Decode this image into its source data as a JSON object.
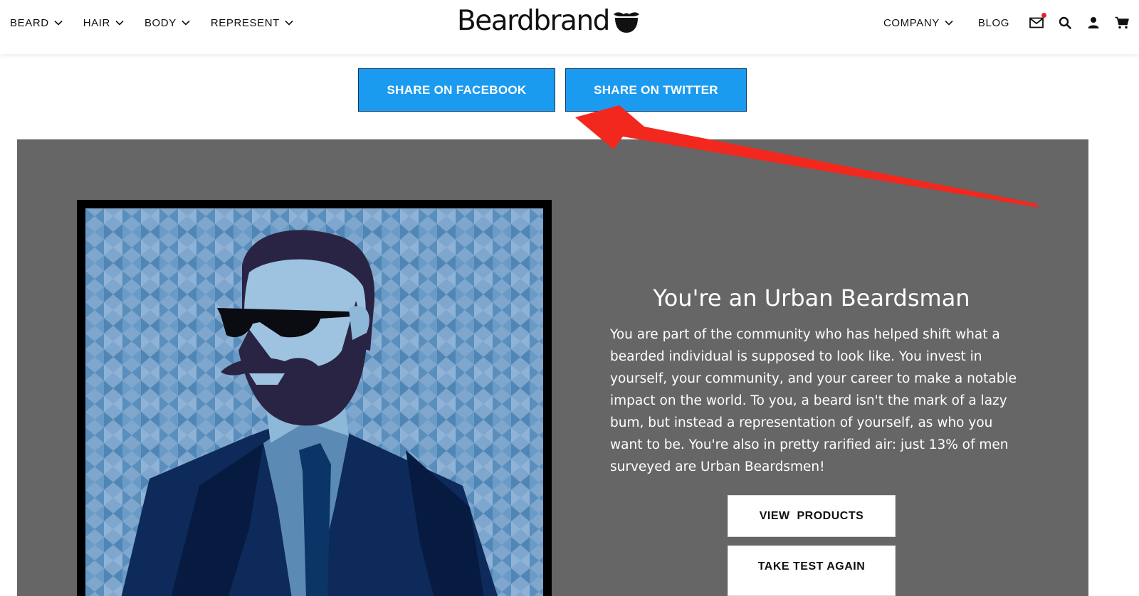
{
  "nav": {
    "left": [
      "BEARD",
      "HAIR",
      "BODY",
      "REPRESENT"
    ],
    "company": "COMPANY",
    "blog": "BLOG",
    "icons": [
      "mail-icon",
      "search-icon",
      "account-icon",
      "cart-icon"
    ]
  },
  "logo": {
    "text": "Beardbrand",
    "icon": "mustache-beard-icon"
  },
  "share": {
    "facebook": "SHARE ON FACEBOOK",
    "twitter": "SHARE ON TWITTER"
  },
  "result": {
    "title": "You're an Urban Beardsman",
    "description": "You are part of the community who has helped shift what a bearded individual is supposed to look like. You invest in yourself, your community, and your career to make a notable impact on the world. To you, a beard isn't the mark of a lazy bum, but instead a representation of yourself, as who you want to be. You're also in pretty rarified air: just 13% of men surveyed are Urban Beardsmen!",
    "view_products": "VIEW  PRODUCTS",
    "take_test_again": "TAKE TEST AGAIN"
  },
  "colors": {
    "share_button": "#1b9bf0",
    "panel": "#666666",
    "arrow": "#f2281e",
    "notification_dot": "#e4202d"
  }
}
